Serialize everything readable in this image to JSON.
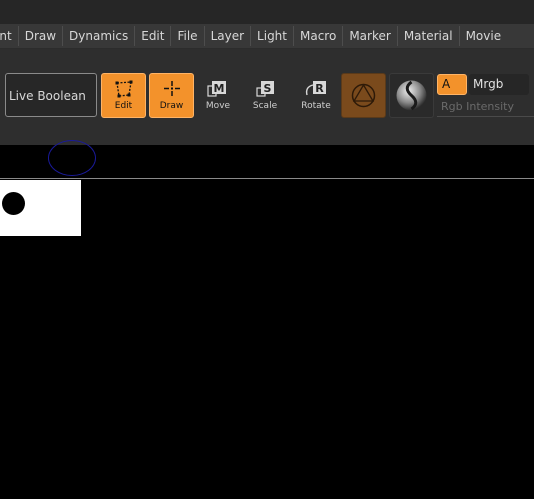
{
  "menu": {
    "items": [
      "ent",
      "Draw",
      "Dynamics",
      "Edit",
      "File",
      "Layer",
      "Light",
      "Macro",
      "Marker",
      "Material",
      "Movie"
    ]
  },
  "toolbar": {
    "live_boolean_label": "Live Boolean",
    "edit_label": "Edit",
    "draw_label": "Draw",
    "move_label": "Move",
    "scale_label": "Scale",
    "rotate_label": "Rotate",
    "move_key": "M",
    "scale_key": "S",
    "rotate_key": "R",
    "a_label": "A",
    "color_mode": "Mrgb",
    "rgb_intensity_label": "Rgb Intensity"
  },
  "colors": {
    "accent": "#f3922b",
    "menubar": "#383838",
    "toolbar": "#2e2e2e",
    "canvas": "#000000"
  }
}
